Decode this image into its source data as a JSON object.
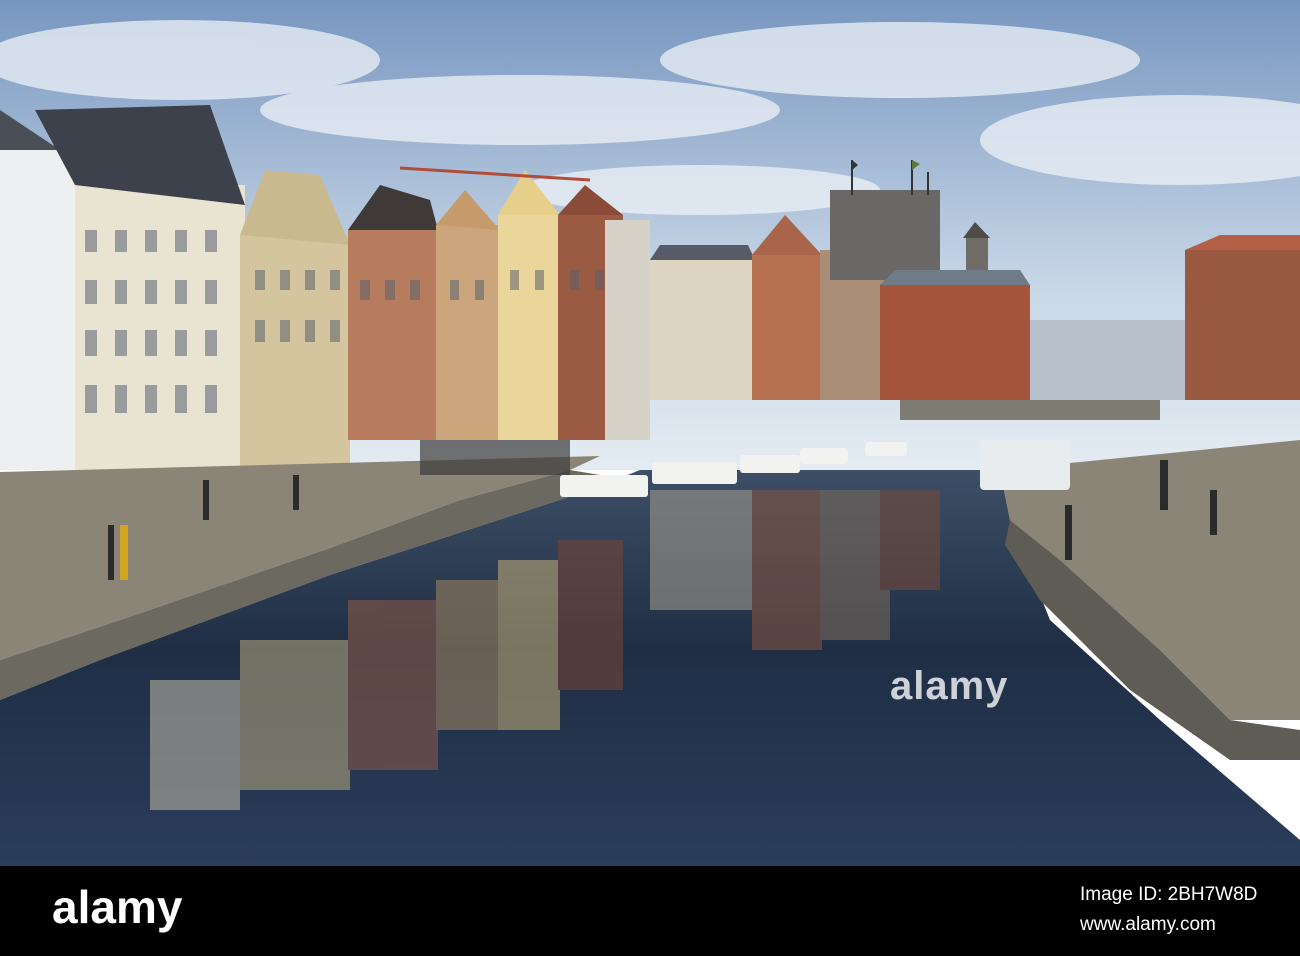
{
  "watermark": {
    "text": "alamy"
  },
  "footer": {
    "logo": "alamy",
    "image_id": "Image ID: 2BH7W8D",
    "url": "www.alamy.com"
  },
  "colors": {
    "sky_top": "#7f9fc6",
    "sky_bottom": "#d9e3ee",
    "water": "#1e2f4a",
    "stone": "#8a8576",
    "footer": "#000000"
  }
}
